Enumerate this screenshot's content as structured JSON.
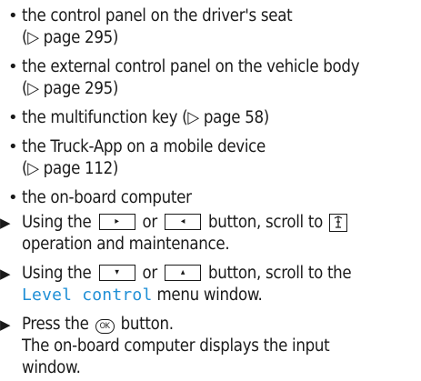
{
  "items": [
    {
      "line1": "the control panel on the driver's seat",
      "line2": "(▷ page 295)"
    },
    {
      "line1": "the external control panel on the vehicle body",
      "line2": "(▷ page 295)"
    },
    {
      "line1": "the multifunction key (▷ page 58)"
    },
    {
      "line1": "the Truck-App on a mobile device",
      "line2": "(▷ page 112)"
    },
    {
      "line1": "the on-board computer"
    }
  ],
  "steps": {
    "s1": {
      "pre": "Using the",
      "key1": "▸",
      "or": "or",
      "key2": "◂",
      "post": "button, scroll to",
      "line2": "operation and maintenance.",
      "icon": "truck-maintenance-icon"
    },
    "s2": {
      "pre": "Using the",
      "key1": "▾",
      "or": "or",
      "key2": "▴",
      "post": "button, scroll to the",
      "menu": "Level control",
      "tail": "menu window."
    },
    "s3": {
      "pre": "Press the",
      "ok": "OK",
      "post": "button.",
      "line2": "The on-board computer displays the input",
      "line3": "window."
    }
  },
  "colors": {
    "menu_text": "#1f8fd6",
    "text": "#1a1a1a"
  }
}
